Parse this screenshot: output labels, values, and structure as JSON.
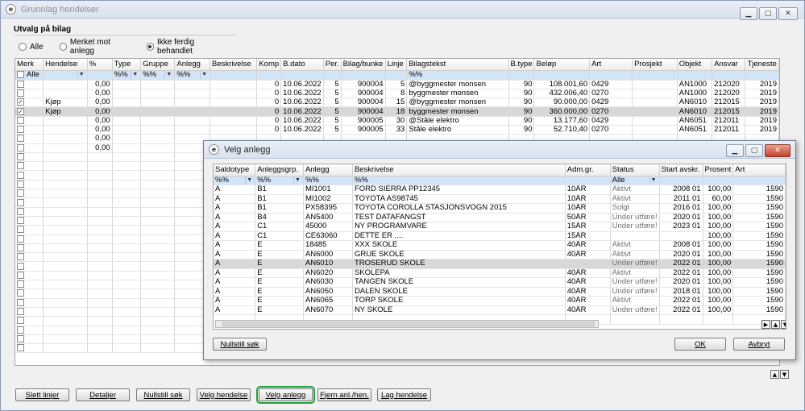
{
  "main": {
    "title": "Grunnlag hendelser",
    "filter_group": {
      "title": "Utvalg på bilag",
      "options": [
        "Alle",
        "Merket mot anlegg",
        "Ikke ferdig behandlet"
      ],
      "selected": "Ikke ferdig behandlet"
    },
    "columns": [
      "Merk",
      "Hendelse",
      "%",
      "Type",
      "Gruppe",
      "Anlegg",
      "Beskrivelse",
      "Komp",
      "B.dato",
      "Per.",
      "Bilag/bunke",
      "Linje",
      "Bilagstekst",
      "B.type",
      "Beløp",
      "Art",
      "Prosjekt",
      "Objekt",
      "Ansvar",
      "Tjeneste"
    ],
    "filter_row": {
      "merk": "Alle",
      "type": "%%",
      "gruppe": "%%",
      "anlegg": "%%",
      "bilagstekst": "%%"
    },
    "rows": [
      {
        "merk": "",
        "hendelse": "",
        "pct": "0,00",
        "komp": "0",
        "bdato": "10.06.2022",
        "per": "5",
        "bilag": "900004",
        "linje": "5",
        "tekst": "@byggmester monsen",
        "btype": "90",
        "belop": "108.001,60",
        "art": "0429",
        "objekt": "AN1000",
        "ansvar": "212020",
        "tjeneste": "2019",
        "checked": false,
        "selected": false
      },
      {
        "merk": "",
        "hendelse": "",
        "pct": "0,00",
        "komp": "0",
        "bdato": "10.06.2022",
        "per": "5",
        "bilag": "900004",
        "linje": "8",
        "tekst": "byggmester monsen",
        "btype": "90",
        "belop": "432.006,40",
        "art": "0270",
        "objekt": "AN1000",
        "ansvar": "212020",
        "tjeneste": "2019",
        "checked": false,
        "selected": false
      },
      {
        "merk": "",
        "hendelse": "Kjøp",
        "pct": "0,00",
        "komp": "0",
        "bdato": "10.06.2022",
        "per": "5",
        "bilag": "900004",
        "linje": "15",
        "tekst": "@byggmester monsen",
        "btype": "90",
        "belop": "90.000,00",
        "art": "0429",
        "objekt": "AN6010",
        "ansvar": "212015",
        "tjeneste": "2019",
        "checked": true,
        "selected": false
      },
      {
        "merk": "",
        "hendelse": "Kjøp",
        "pct": "0,00",
        "komp": "0",
        "bdato": "10.06.2022",
        "per": "5",
        "bilag": "900004",
        "linje": "18",
        "tekst": "byggmester monsen",
        "btype": "90",
        "belop": "360.000,00",
        "art": "0270",
        "objekt": "AN6010",
        "ansvar": "212015",
        "tjeneste": "2019",
        "checked": true,
        "selected": true
      },
      {
        "merk": "",
        "hendelse": "",
        "pct": "0,00",
        "komp": "0",
        "bdato": "10.06.2022",
        "per": "5",
        "bilag": "900005",
        "linje": "30",
        "tekst": "@Ståle elektro",
        "btype": "90",
        "belop": "13.177,60",
        "art": "0429",
        "objekt": "AN6051",
        "ansvar": "212011",
        "tjeneste": "2019",
        "checked": false,
        "selected": false
      },
      {
        "merk": "",
        "hendelse": "",
        "pct": "0,00",
        "komp": "0",
        "bdato": "10.06.2022",
        "per": "5",
        "bilag": "900005",
        "linje": "33",
        "tekst": "Ståle elektro",
        "btype": "90",
        "belop": "52.710,40",
        "art": "0270",
        "objekt": "AN6051",
        "ansvar": "212011",
        "tjeneste": "2019",
        "checked": false,
        "selected": false
      },
      {
        "merk": "",
        "hendelse": "",
        "pct": "0,00",
        "komp": "",
        "bdato": "",
        "per": "",
        "bilag": "",
        "linje": "",
        "tekst": "",
        "btype": "",
        "belop": "",
        "art": "",
        "objekt": "",
        "ansvar": "",
        "tjeneste": "",
        "checked": false,
        "selected": false
      },
      {
        "merk": "",
        "hendelse": "",
        "pct": "0,00",
        "komp": "",
        "bdato": "",
        "per": "",
        "bilag": "",
        "linje": "",
        "tekst": "",
        "btype": "",
        "belop": "",
        "art": "",
        "objekt": "",
        "ansvar": "",
        "tjeneste": "",
        "checked": false,
        "selected": false
      }
    ],
    "buttons": [
      "Slett linjer",
      "Detaljer",
      "Nullstill søk",
      "Velg hendelse",
      "Velg anlegg",
      "Fjern anl./hen.",
      "Lag hendelse"
    ]
  },
  "dialog": {
    "title": "Velg anlegg",
    "columns": [
      "Saldotype",
      "Anleggsgrp.",
      "Anlegg",
      "Beskrivelse",
      "Adm.gr.",
      "Status",
      "Start avskr.",
      "Prosent",
      "Art"
    ],
    "filter_row": {
      "saldotype": "%%",
      "grp": "%%",
      "anlegg": "%%",
      "beskrivelse": "%%",
      "status": "Alle"
    },
    "rows": [
      {
        "saldotype": "A",
        "grp": "B1",
        "anlegg": "MI1001",
        "beskrivelse": "FORD SIERRA PP12345",
        "adm": "10ÅR",
        "status": "Aktivt",
        "start": "2008 01",
        "prosent": "100,00",
        "art": "1590"
      },
      {
        "saldotype": "A",
        "grp": "B1",
        "anlegg": "MI1002",
        "beskrivelse": "TOYOTA AS98745",
        "adm": "10ÅR",
        "status": "Aktivt",
        "start": "2011 01",
        "prosent": "60,00",
        "art": "1590"
      },
      {
        "saldotype": "A",
        "grp": "B1",
        "anlegg": "PX58395",
        "beskrivelse": "TOYOTA COROLLA STASJONSVOGN 2015",
        "adm": "10ÅR",
        "status": "Solgt",
        "start": "2016 01",
        "prosent": "100,00",
        "art": "1590"
      },
      {
        "saldotype": "A",
        "grp": "B4",
        "anlegg": "AN5400",
        "beskrivelse": "TEST DATAFANGST",
        "adm": "50ÅR",
        "status": "Under utføre!",
        "start": "2020 01",
        "prosent": "100,00",
        "art": "1590"
      },
      {
        "saldotype": "A",
        "grp": "C1",
        "anlegg": "45000",
        "beskrivelse": "NY PROGRAMVARE",
        "adm": "15ÅR",
        "status": "Under utføre!",
        "start": "2023 01",
        "prosent": "100,00",
        "art": "1590"
      },
      {
        "saldotype": "A",
        "grp": "C1",
        "anlegg": "CE63060",
        "beskrivelse": "DETTE ER ....",
        "adm": "15ÅR",
        "status": "",
        "start": "",
        "prosent": "100,00",
        "art": "1590"
      },
      {
        "saldotype": "A",
        "grp": "E",
        "anlegg": "18485",
        "beskrivelse": "XXX SKOLE",
        "adm": "40ÅR",
        "status": "Aktivt",
        "start": "2008 01",
        "prosent": "100,00",
        "art": "1590"
      },
      {
        "saldotype": "A",
        "grp": "E",
        "anlegg": "AN6000",
        "beskrivelse": "GRUE SKOLE",
        "adm": "40ÅR",
        "status": "Aktivt",
        "start": "2020 01",
        "prosent": "100,00",
        "art": "1590"
      },
      {
        "saldotype": "A",
        "grp": "E",
        "anlegg": "AN6010",
        "beskrivelse": "TROSERUD SKOLE",
        "adm": "",
        "status": "Under utføre!",
        "start": "2022 01",
        "prosent": "100,00",
        "art": "1590",
        "selected": true
      },
      {
        "saldotype": "A",
        "grp": "E",
        "anlegg": "AN6020",
        "beskrivelse": "SKOLEPA",
        "adm": "40ÅR",
        "status": "Aktivt",
        "start": "2022 01",
        "prosent": "100,00",
        "art": "1590"
      },
      {
        "saldotype": "A",
        "grp": "E",
        "anlegg": "AN6030",
        "beskrivelse": "TANGEN SKOLE",
        "adm": "40ÅR",
        "status": "Under utføre!",
        "start": "2020 01",
        "prosent": "100,00",
        "art": "1590"
      },
      {
        "saldotype": "A",
        "grp": "E",
        "anlegg": "AN6050",
        "beskrivelse": "DALEN SKOLE",
        "adm": "40ÅR",
        "status": "Under utføre!",
        "start": "2018 01",
        "prosent": "100,00",
        "art": "1590"
      },
      {
        "saldotype": "A",
        "grp": "E",
        "anlegg": "AN6065",
        "beskrivelse": "TORP SKOLE",
        "adm": "40ÅR",
        "status": "Aktivt",
        "start": "2022 01",
        "prosent": "100,00",
        "art": "1590"
      },
      {
        "saldotype": "A",
        "grp": "E",
        "anlegg": "AN6070",
        "beskrivelse": "NY SKOLE",
        "adm": "40ÅR",
        "status": "Under utføre!",
        "start": "2022 01",
        "prosent": "100,00",
        "art": "1590"
      }
    ],
    "buttons": {
      "reset": "Nullstill søk",
      "ok": "OK",
      "cancel": "Avbryt"
    }
  }
}
